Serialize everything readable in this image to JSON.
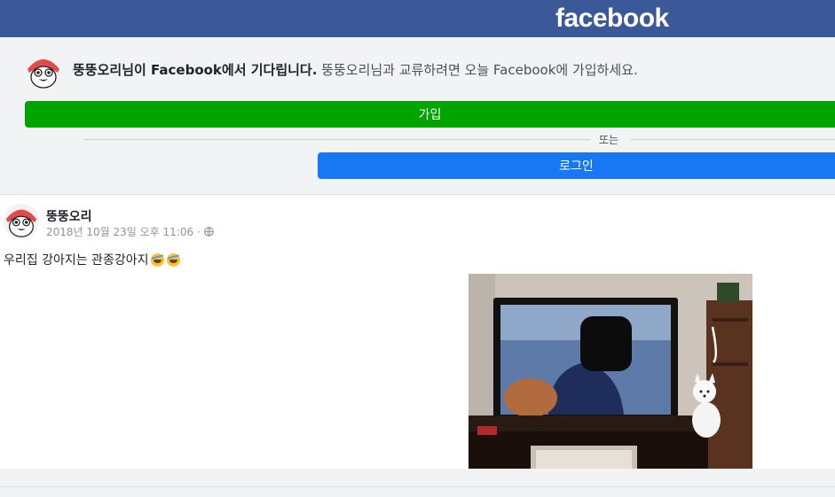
{
  "header": {
    "logo_text": "facebook",
    "bar_color": "#3b5998"
  },
  "banner": {
    "avatar_icon": "duck-avatar-icon",
    "bold_message": "뚱뚱오리님이 Facebook에서 기다립니다.",
    "message": " 뚱뚱오리님과 교류하려면 오늘 Facebook에 가입하세요.",
    "signup_label": "가입",
    "or_label": "또는",
    "login_label": "로그인",
    "signup_color": "#00a400",
    "login_color": "#1877f2"
  },
  "post": {
    "author": "뚱뚱오리",
    "timestamp": "2018년 10월 23일 오후 11:06",
    "separator": "·",
    "privacy_icon": "globe-icon",
    "text": "우리집 강아지는 관종강아지",
    "emojis": [
      "rolling-on-floor-laughing-icon",
      "rolling-on-floor-laughing-icon"
    ],
    "photo": "photo of a white dog sitting next to a TV"
  }
}
